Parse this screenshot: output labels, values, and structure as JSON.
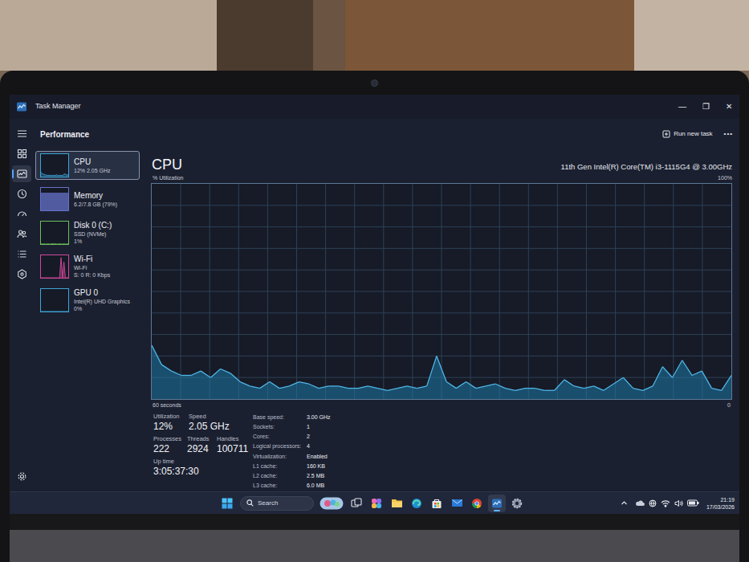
{
  "window": {
    "title": "Task Manager",
    "controls": [
      "—",
      "❐",
      "✕"
    ]
  },
  "nav": [
    {
      "kind": "menu",
      "selected": false
    },
    {
      "kind": "processes",
      "selected": false
    },
    {
      "kind": "performance",
      "selected": true
    },
    {
      "kind": "app-history",
      "selected": false
    },
    {
      "kind": "startup",
      "selected": false
    },
    {
      "kind": "users",
      "selected": false
    },
    {
      "kind": "details",
      "selected": false
    },
    {
      "kind": "services",
      "selected": false
    },
    {
      "kind": "settings",
      "selected": false
    }
  ],
  "page": {
    "title": "Performance",
    "run_new_task": "Run new task",
    "more": "•••"
  },
  "resources": [
    {
      "name": "CPU",
      "lines": [
        "12% 2.05 GHz"
      ],
      "selected": true,
      "kind": "line",
      "color": "#3fa4d8",
      "graph": [
        20,
        12,
        10,
        8,
        6,
        5,
        6,
        5,
        5,
        6,
        5,
        8,
        5,
        5,
        6,
        5,
        10,
        12,
        6,
        9
      ]
    },
    {
      "name": "Memory",
      "lines": [
        "6.2/7.8 GB (79%)"
      ],
      "selected": false,
      "kind": "fill",
      "color": "#6571c9",
      "level": 0.79
    },
    {
      "name": "Disk 0 (C:)",
      "lines": [
        "SSD (NVMe)",
        "1%"
      ],
      "selected": false,
      "kind": "line",
      "color": "#6bbf59",
      "graph": [
        1,
        0,
        1,
        0,
        0,
        1,
        0,
        0,
        2,
        0,
        1,
        0,
        0,
        1,
        0,
        0,
        1,
        0,
        0,
        1
      ]
    },
    {
      "name": "Wi-Fi",
      "lines": [
        "Wi-Fi",
        "S: 0 R: 0 Kbps"
      ],
      "selected": false,
      "kind": "line",
      "color": "#d0479a",
      "graph": [
        0,
        0,
        0,
        0,
        0,
        0,
        0,
        0,
        0,
        0,
        0,
        0,
        0,
        0,
        90,
        0,
        70,
        0,
        0,
        0
      ]
    },
    {
      "name": "GPU 0",
      "lines": [
        "Intel(R) UHD Graphics",
        "0%"
      ],
      "selected": false,
      "kind": "line",
      "color": "#3fa4d8",
      "graph": [
        0,
        0,
        0,
        0,
        0,
        0,
        0,
        0,
        0,
        0,
        0,
        0,
        0,
        0,
        0,
        0,
        0,
        0,
        0,
        0
      ]
    }
  ],
  "cpu": {
    "title": "CPU",
    "model": "11th Gen Intel(R) Core(TM) i3-1115G4 @ 3.00GHz",
    "y_label": "% Utilization",
    "y_max": "100%",
    "x_label": "60 seconds",
    "x_min": "0",
    "series": [
      25,
      16,
      13,
      11,
      11,
      13,
      10,
      14,
      12,
      8,
      6,
      5,
      8,
      5,
      6,
      8,
      7,
      5,
      6,
      6,
      5,
      5,
      6,
      5,
      4,
      5,
      6,
      5,
      6,
      20,
      8,
      5,
      8,
      5,
      6,
      7,
      5,
      4,
      5,
      5,
      4,
      4,
      9,
      6,
      5,
      6,
      4,
      7,
      10,
      5,
      4,
      6,
      15,
      10,
      18,
      11,
      13,
      5,
      4,
      11
    ]
  },
  "stats": [
    [
      {
        "label": "Utilization",
        "value": "12%"
      },
      {
        "label": "Speed",
        "value": "2.05 GHz"
      }
    ],
    [
      {
        "label": "Processes",
        "value": "222"
      },
      {
        "label": "Threads",
        "value": "2924"
      },
      {
        "label": "Handles",
        "value": "100711"
      }
    ],
    [
      {
        "label": "Up time",
        "value": "3:05:37:30"
      }
    ]
  ],
  "specs": [
    {
      "label": "Base speed:",
      "value": "3.00 GHz"
    },
    {
      "label": "Sockets:",
      "value": "1"
    },
    {
      "label": "Cores:",
      "value": "2"
    },
    {
      "label": "Logical processors:",
      "value": "4"
    },
    {
      "label": "Virtualization:",
      "value": "Enabled"
    },
    {
      "label": "L1 cache:",
      "value": "160 KB"
    },
    {
      "label": "L2 cache:",
      "value": "2.5 MB"
    },
    {
      "label": "L3 cache:",
      "value": "6.0 MB"
    }
  ],
  "taskbar": {
    "search": "Search",
    "apps": [
      {
        "kind": "start",
        "selected": false
      },
      {
        "kind": "search-highlight",
        "selected": false
      },
      {
        "kind": "taskview",
        "selected": false
      },
      {
        "kind": "copilot",
        "selected": false
      },
      {
        "kind": "explorer",
        "selected": false
      },
      {
        "kind": "edge",
        "selected": false
      },
      {
        "kind": "store",
        "selected": false
      },
      {
        "kind": "mail",
        "selected": false
      },
      {
        "kind": "chrome",
        "selected": false
      },
      {
        "kind": "taskmanager",
        "selected": true
      },
      {
        "kind": "settings",
        "selected": false
      }
    ],
    "tray": [
      {
        "kind": "chevron"
      },
      {
        "kind": "onedrive"
      },
      {
        "kind": "network"
      },
      {
        "kind": "wifi"
      },
      {
        "kind": "volume"
      },
      {
        "kind": "battery"
      }
    ],
    "time": "21:19",
    "date": "17/03/2026"
  }
}
